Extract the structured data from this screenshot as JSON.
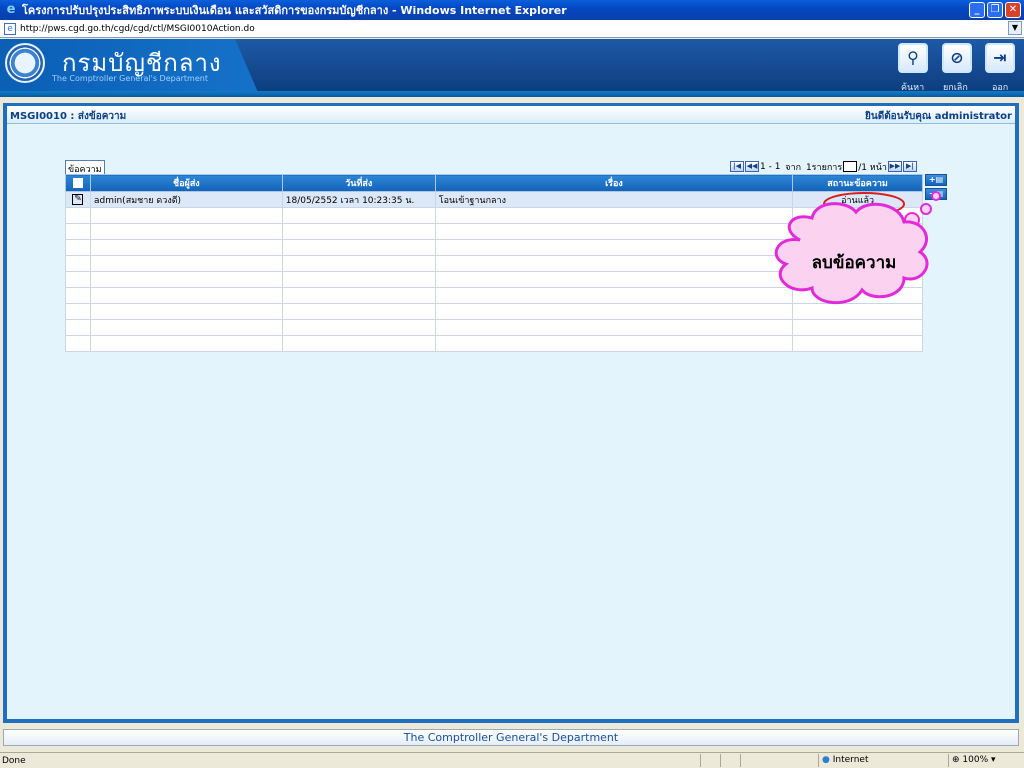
{
  "window": {
    "title": "โครงการปรับปรุงประสิทธิภาพระบบเงินเดือน และสวัสดิการของกรมบัญชีกลาง - Windows Internet Explorer",
    "url": "http://pws.cgd.go.th/cgd/cgd/ctl/MSGI0010Action.do"
  },
  "header": {
    "org_th": "กรมบัญชีกลาง",
    "org_en": "The Comptroller General's Department",
    "buttons": [
      {
        "icon": "search-icon",
        "label": "ค้นหา",
        "glyph": "⚲"
      },
      {
        "icon": "cancel-icon",
        "label": "ยกเลิก",
        "glyph": "⊘"
      },
      {
        "icon": "exit-icon",
        "label": "ออก",
        "glyph": "⇥"
      }
    ]
  },
  "page": {
    "code_title": "MSGI0010 : ส่งข้อความ",
    "welcome": "ยินดีต้อนรับคุณ administrator",
    "tab_label": "ข้อความ",
    "pager": {
      "range": "1 - 1",
      "of": "จาก",
      "total": "1รายการ",
      "page_suffix": "/1 หน้า"
    }
  },
  "table": {
    "columns": [
      "ชื่อผู้ส่ง",
      "วันที่ส่ง",
      "เรื่อง",
      "สถานะข้อความ"
    ],
    "rows": [
      {
        "sender": "admin(สมชาย ดวงดี)",
        "date": "18/05/2552 เวลา 10:23:35 น.",
        "subject": "โอนเข้าฐานกลาง",
        "status": "อ่านแล้ว"
      }
    ]
  },
  "annotation": {
    "callout_text": "ลบข้อความ",
    "color": "#e22bd8",
    "fill": "#fbd3f0"
  },
  "footer": {
    "text": "The Comptroller General's Department"
  },
  "statusbar": {
    "done": "Done",
    "zone": "Internet",
    "zoom": "100%"
  }
}
